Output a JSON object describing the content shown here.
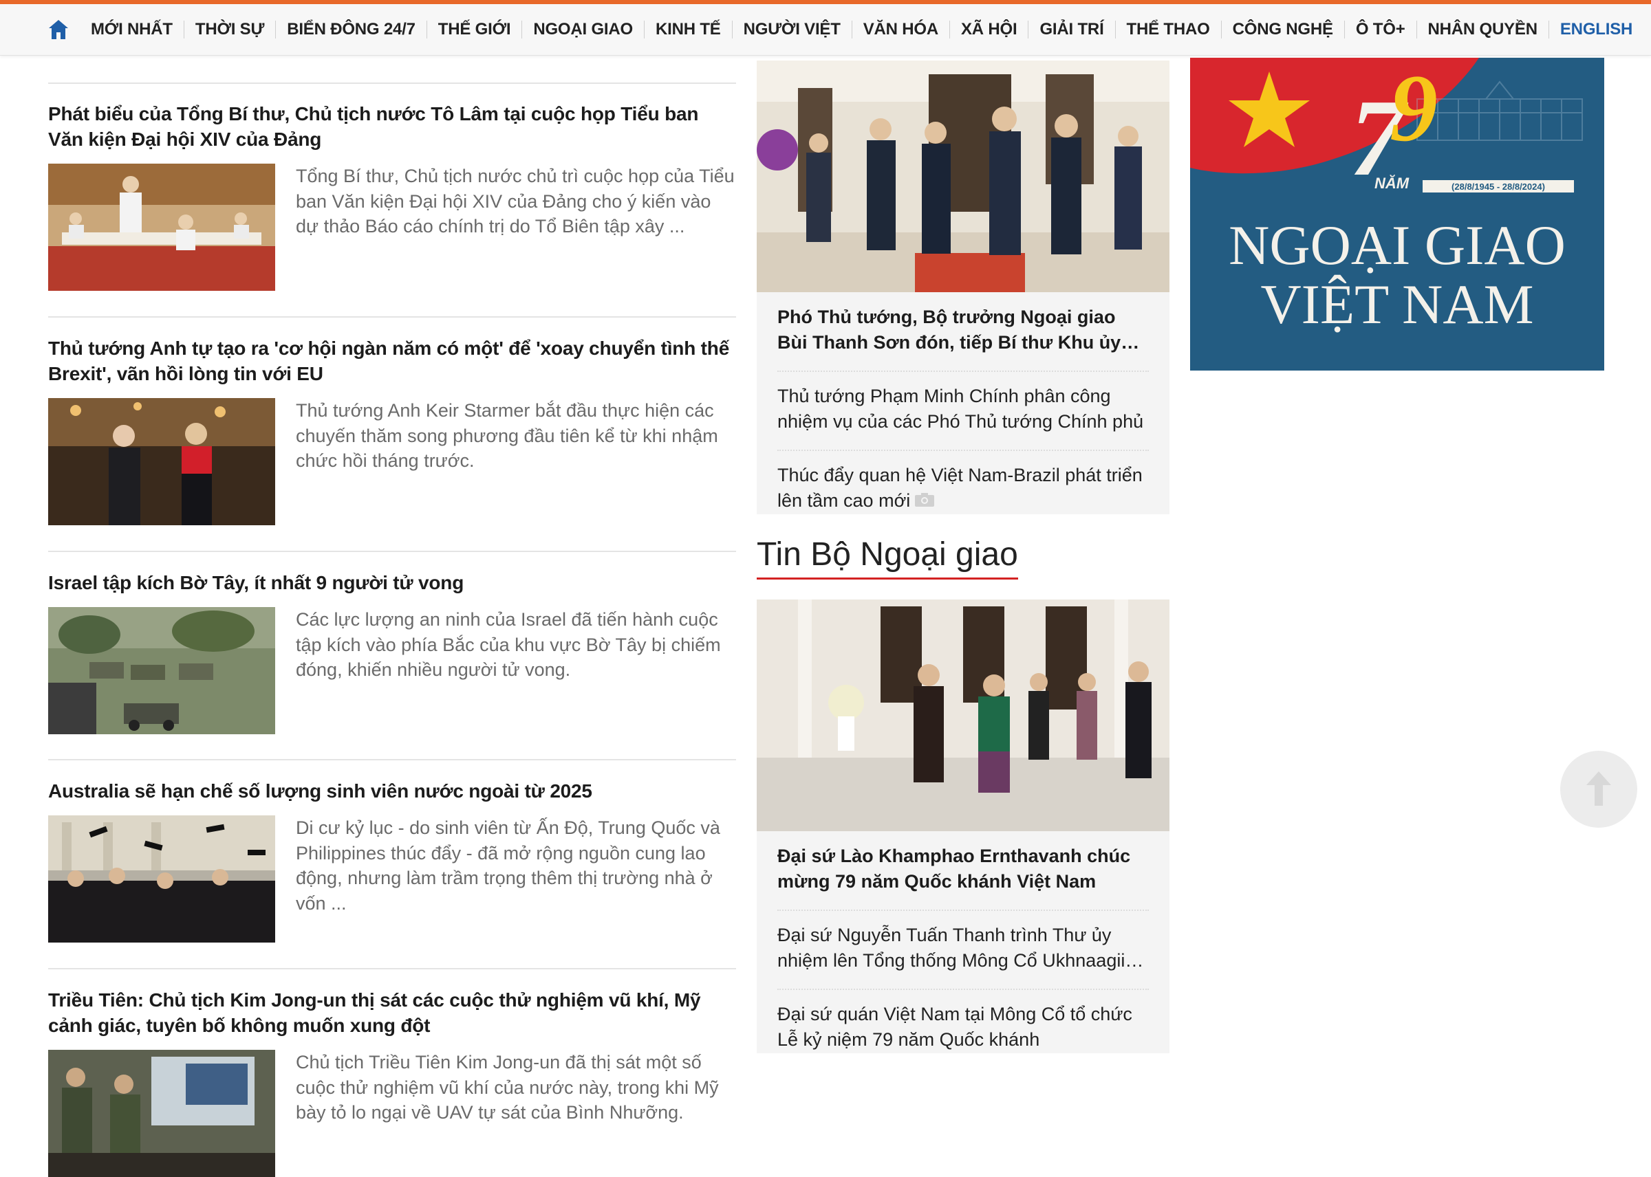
{
  "nav": {
    "home_icon": "home-icon",
    "items": [
      "MỚI NHẤT",
      "THỜI SỰ",
      "BIỂN ĐÔNG 24/7",
      "THẾ GIỚI",
      "NGOẠI GIAO",
      "KINH TẾ",
      "NGƯỜI VIỆT",
      "VĂN HÓA",
      "XÃ HỘI",
      "GIẢI TRÍ",
      "THỂ THAO",
      "CÔNG NGHỆ",
      "Ô TÔ+",
      "NHÂN QUYỀN",
      "ENGLISH"
    ],
    "accent_color": "#e8692a",
    "english_color": "#1f5fa8"
  },
  "articles": [
    {
      "title": "Phát biểu của Tổng Bí thư, Chủ tịch nước Tô Lâm tại cuộc họp Tiểu ban Văn kiện Đại hội XIV của Đảng",
      "summary": "Tổng Bí thư, Chủ tịch nước chủ trì cuộc họp của Tiểu ban Văn kiện Đại hội XIV của Đảng cho ý kiến vào dự thảo Báo cáo chính trị do Tổ Biên tập xây ..."
    },
    {
      "title": "Thủ tướng Anh tự tạo ra 'cơ hội ngàn năm có một' để 'xoay chuyển tình thế Brexit', vãn hồi lòng tin với EU",
      "summary": "Thủ tướng Anh Keir Starmer bắt đầu thực hiện các chuyến thăm song phương đầu tiên kể từ khi nhậm chức hồi tháng trước."
    },
    {
      "title": "Israel tập kích Bờ Tây, ít nhất 9 người tử vong",
      "summary": "Các lực lượng an ninh của Israel đã tiến hành cuộc tập kích vào phía Bắc của khu vực Bờ Tây bị chiếm đóng, khiến nhiều người tử vong."
    },
    {
      "title": "Australia sẽ hạn chế số lượng sinh viên nước ngoài từ 2025",
      "summary": "Di cư kỷ lục - do sinh viên từ Ấn Độ, Trung Quốc và Philippines thúc đẩy - đã mở rộng nguồn cung lao động, nhưng làm trầm trọng thêm thị trường nhà ở vốn ..."
    },
    {
      "title": "Triều Tiên: Chủ tịch Kim Jong-un thị sát các cuộc thử nghiệm vũ khí, Mỹ cảnh giác, tuyên bố không muốn xung đột",
      "summary": "Chủ tịch Triều Tiên Kim Jong-un đã thị sát một số cuộc thử nghiệm vũ khí của nước này, trong khi Mỹ bày tỏ lo ngại về UAV tự sát của Bình Nhưỡng."
    }
  ],
  "ngoai_giao_box": {
    "headline": "Phó Thủ tướng, Bộ trưởng Ngoại giao Bùi Thanh Sơn đón, tiếp Bí thư Khu ủy Quảng Tây",
    "links": [
      "Thủ tướng Phạm Minh Chính phân công nhiệm vụ của các Phó Thủ tướng Chính phủ",
      "Thúc đẩy quan hệ Việt Nam-Brazil phát triển lên tầm cao mới"
    ],
    "camera_icon": "camera-icon"
  },
  "tin_bo": {
    "section_title": "Tin Bộ Ngoại giao",
    "headline": "Đại sứ Lào Khamphao Ernthavanh chúc mừng 79 năm Quốc khánh Việt Nam",
    "links": [
      "Đại sứ Nguyễn Tuấn Thanh trình Thư ủy nhiệm lên Tổng thống Mông Cổ Ukhnaagiin Khurelsukh",
      "Đại sứ quán Việt Nam tại Mông Cổ tổ chức Lễ kỷ niệm 79 năm Quốc khánh"
    ]
  },
  "banner": {
    "number": "79",
    "nam": "NĂM",
    "dates": "(28/8/1945 - 28/8/2024)",
    "line1": "NGOẠI GIAO",
    "line2": "VIỆT NAM",
    "bg_color": "#235c82",
    "flag_color": "#d8262d",
    "star_color": "#f7c61a"
  },
  "scroll_top_icon": "arrow-up-icon"
}
